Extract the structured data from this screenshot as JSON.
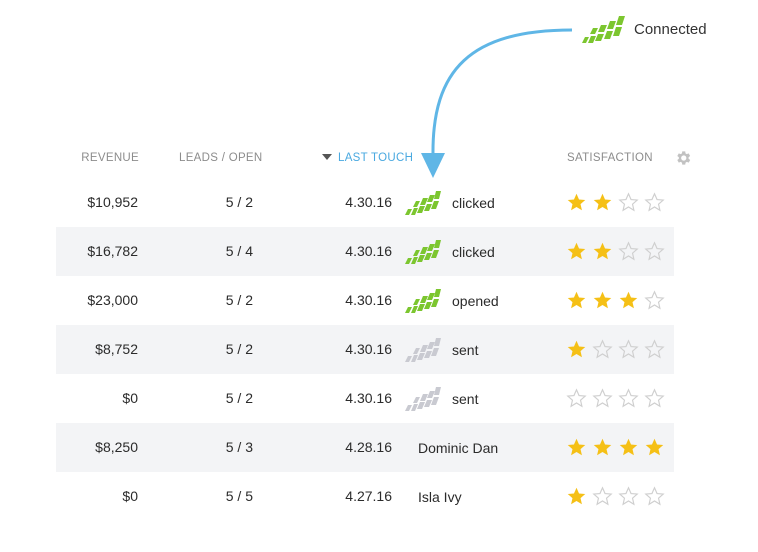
{
  "status": {
    "label": "Connected",
    "icon": "connected-logo-icon"
  },
  "columns": {
    "revenue": "REVENUE",
    "leads_open": "LEADS / OPEN",
    "last_touch": "LAST TOUCH",
    "satisfaction": "SATISFACTION",
    "settings_icon": "gear-icon",
    "sort_icon": "sort-desc-icon"
  },
  "colors": {
    "accent": "#4aa9e0",
    "logo_active": "#7cc62f",
    "logo_inactive": "#c9cad1",
    "star": "#f5c016",
    "row_alt": "#f3f4f6"
  },
  "rows": [
    {
      "revenue": "$10,952",
      "leads": "5 / 2",
      "date": "4.30.16",
      "activity": "clicked",
      "logo": "active",
      "rating": 2
    },
    {
      "revenue": "$16,782",
      "leads": "5 / 4",
      "date": "4.30.16",
      "activity": "clicked",
      "logo": "active",
      "rating": 2
    },
    {
      "revenue": "$23,000",
      "leads": "5 / 2",
      "date": "4.30.16",
      "activity": "opened",
      "logo": "active",
      "rating": 3
    },
    {
      "revenue": "$8,752",
      "leads": "5 / 2",
      "date": "4.30.16",
      "activity": "sent",
      "logo": "inactive",
      "rating": 1
    },
    {
      "revenue": "$0",
      "leads": "5 / 2",
      "date": "4.30.16",
      "activity": "sent",
      "logo": "inactive",
      "rating": 0
    },
    {
      "revenue": "$8,250",
      "leads": "5 / 3",
      "date": "4.28.16",
      "activity": "Dominic Dan",
      "logo": "none",
      "rating": 4
    },
    {
      "revenue": "$0",
      "leads": "5 / 5",
      "date": "4.27.16",
      "activity": "Isla Ivy",
      "logo": "none",
      "rating": 1
    }
  ],
  "rating_max": 4
}
